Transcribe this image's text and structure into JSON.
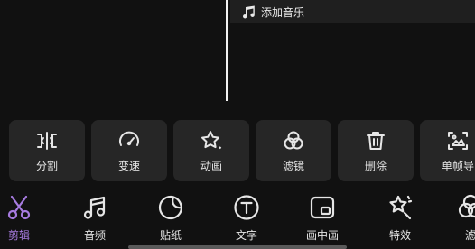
{
  "timeline": {
    "add_music_label": "添加音乐"
  },
  "tools": [
    {
      "label": "分割",
      "icon": "split-icon"
    },
    {
      "label": "变速",
      "icon": "speed-gauge-icon"
    },
    {
      "label": "动画",
      "icon": "star-animation-icon"
    },
    {
      "label": "滤镜",
      "icon": "filter-circles-icon"
    },
    {
      "label": "删除",
      "icon": "trash-icon"
    },
    {
      "label": "单帧导",
      "icon": "frame-export-icon"
    }
  ],
  "nav": [
    {
      "label": "剪辑",
      "icon": "scissors-icon",
      "active": true
    },
    {
      "label": "音频",
      "icon": "music-note-icon",
      "active": false
    },
    {
      "label": "贴纸",
      "icon": "sticker-icon",
      "active": false
    },
    {
      "label": "文字",
      "icon": "text-icon",
      "active": false
    },
    {
      "label": "画中画",
      "icon": "picture-in-picture-icon",
      "active": false
    },
    {
      "label": "特效",
      "icon": "effects-icon",
      "active": false
    },
    {
      "label": "滤",
      "icon": "filter-icon",
      "active": false
    }
  ],
  "colors": {
    "accent": "#a77be0",
    "card_bg": "#262626",
    "bg": "#111111"
  }
}
